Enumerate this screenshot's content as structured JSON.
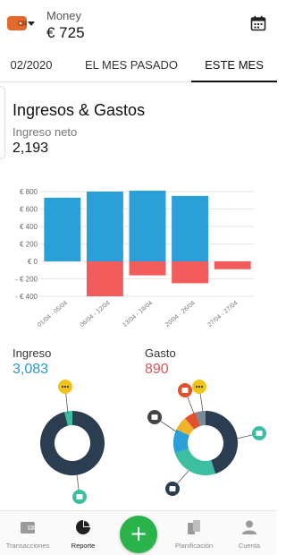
{
  "header": {
    "account_name": "Money",
    "balance": "€ 725",
    "icons": {
      "wallet": "wallet-icon",
      "caret": "caret-down-icon",
      "calendar": "calendar-icon"
    },
    "wallet_color": "#e26a2c"
  },
  "tabs": [
    {
      "label": "02/2020",
      "active": false
    },
    {
      "label": "EL MES PASADO",
      "active": false
    },
    {
      "label": "ESTE MES",
      "active": true
    }
  ],
  "report": {
    "title": "Ingresos & Gastos",
    "net_label": "Ingreso neto",
    "net_value": "2,193"
  },
  "chart_data": {
    "type": "bar",
    "categories": [
      "01/04 - 05/04",
      "06/04 - 12/04",
      "13/04 - 19/04",
      "20/04 - 26/04",
      "27/04 - 27/04"
    ],
    "series": [
      {
        "values": [
          730,
          800,
          810,
          750,
          0
        ],
        "color": "#2a9fd8"
      },
      {
        "values": [
          0,
          -400,
          -160,
          -250,
          -90
        ],
        "color": "#f25c5c"
      }
    ],
    "y_ticks": [
      "€ 800",
      "€ 600",
      "€ 400",
      "€ 200",
      "€ 0",
      "- € 200",
      "- € 400"
    ],
    "ylim": [
      -400,
      800
    ],
    "grid": true
  },
  "summary": {
    "income_label": "Ingreso",
    "income_value": "3,083",
    "income_color": "#2a97c9",
    "expense_label": "Gasto",
    "expense_value": "890",
    "expense_color": "#e05555"
  },
  "income_donut": {
    "segments": [
      {
        "share": 0.96,
        "color": "#2b3d50",
        "icon": "money-icon"
      },
      {
        "share": 0.04,
        "color": "#3bbfa0",
        "icon": "more-icon"
      }
    ]
  },
  "expense_donut": {
    "segments": [
      {
        "share": 0.45,
        "color": "#2b3d50",
        "icon": "shopping-bag-icon"
      },
      {
        "share": 0.25,
        "color": "#3bbfa0",
        "icon": "food-icon"
      },
      {
        "share": 0.12,
        "color": "#2a9fd8",
        "icon": "receipt-icon"
      },
      {
        "share": 0.07,
        "color": "#f0b429",
        "icon": "gift-icon"
      },
      {
        "share": 0.06,
        "color": "#e2502c",
        "icon": "more-icon"
      },
      {
        "share": 0.05,
        "color": "#7a8a99",
        "icon": "receipt-icon"
      }
    ]
  },
  "bottom_nav": [
    {
      "label": "Transacciones",
      "icon": "wallet-icon",
      "active": false
    },
    {
      "label": "Reporte",
      "icon": "pie-chart-icon",
      "active": true
    },
    {
      "label": "Planificación",
      "icon": "planning-icon",
      "active": false
    },
    {
      "label": "Cuenta",
      "icon": "user-icon",
      "active": false
    }
  ],
  "fab": {
    "label": "+",
    "color": "#2bb34b",
    "icon": "plus-icon"
  }
}
